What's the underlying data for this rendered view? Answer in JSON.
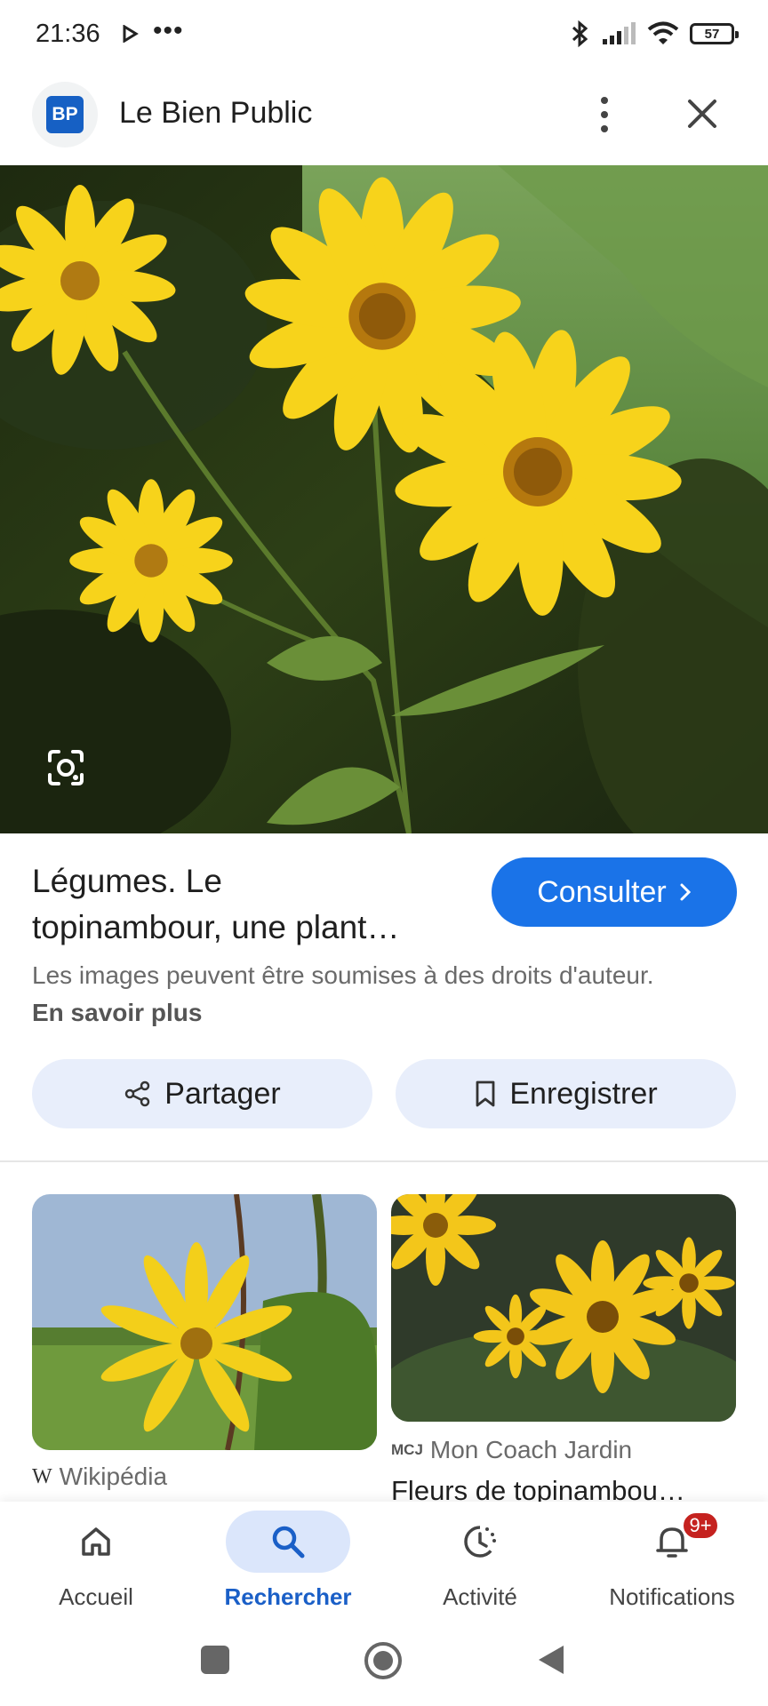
{
  "status_bar": {
    "time": "21:36",
    "dots": "•••",
    "battery": "57",
    "icons": [
      "play-icon",
      "bluetooth-icon",
      "signal-icon",
      "wifi-icon",
      "battery-icon"
    ]
  },
  "header": {
    "logo_text": "BP",
    "site_name": "Le Bien Public",
    "icons": [
      "more-vert-icon",
      "close-icon"
    ]
  },
  "hero": {
    "icons": [
      "lens-icon"
    ]
  },
  "result": {
    "title_line1": "Légumes. Le",
    "title_line2": "topinambour, une plant…",
    "consult_label": "Consulter",
    "rights_text": "Les images peuvent être soumises à des droits d'auteur.",
    "learn_more": "En savoir plus"
  },
  "actions": {
    "share_label": "Partager",
    "save_label": "Enregistrer"
  },
  "related": [
    {
      "source": "Wikipédia",
      "source_logo": "W",
      "title": ""
    },
    {
      "source": "Mon Coach Jardin",
      "source_logo": "MCJ",
      "title": "Fleurs de topinambou…"
    }
  ],
  "bottom_nav": {
    "items": [
      {
        "label": "Accueil",
        "icon": "home-icon"
      },
      {
        "label": "Rechercher",
        "icon": "search-icon",
        "active": true
      },
      {
        "label": "Activité",
        "icon": "history-icon"
      },
      {
        "label": "Notifications",
        "icon": "bell-icon",
        "badge": "9+"
      }
    ]
  },
  "colors": {
    "accent": "#1a73e8",
    "pill_bg": "#e8eefb",
    "badge": "#c5221f",
    "flower": "#f6d21a"
  }
}
